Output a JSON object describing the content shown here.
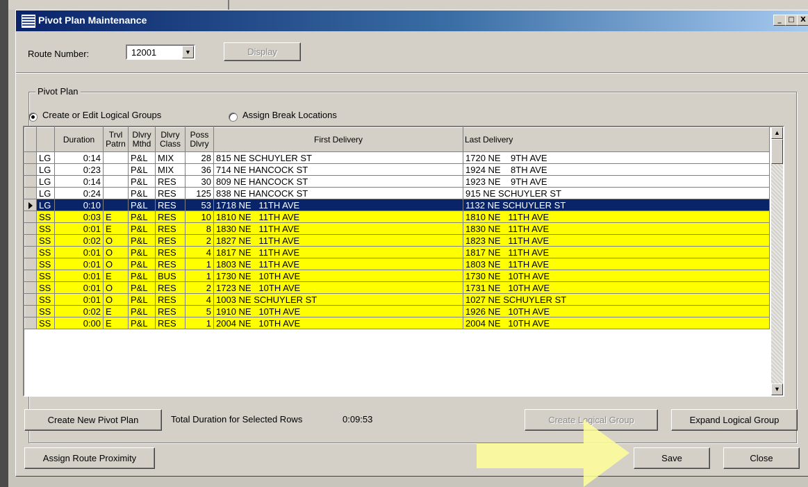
{
  "window": {
    "title": "Pivot Plan Maintenance",
    "minimize_glyph": "_",
    "restore_glyph": "□",
    "close_glyph": "X"
  },
  "route": {
    "label": "Route Number:",
    "value": "12001",
    "display_button": "Display"
  },
  "pivot_plan": {
    "group_title": "Pivot Plan",
    "radio_options": [
      {
        "label": "Create or Edit Logical Groups",
        "selected": true
      },
      {
        "label": "Assign Break Locations",
        "selected": false
      }
    ]
  },
  "grid": {
    "headers": {
      "duration": "Duration",
      "trvl_patrn_1": "Trvl",
      "trvl_patrn_2": "Patrn",
      "dlvry_mthd_1": "Dlvry",
      "dlvry_mthd_2": "Mthd",
      "dlvry_class_1": "Dlvry",
      "dlvry_class_2": "Class",
      "poss_dlvry_1": "Poss",
      "poss_dlvry_2": "Dlvry",
      "first_delivery": "First Delivery",
      "last_delivery": "Last Delivery"
    },
    "rows": [
      {
        "type": "LG",
        "duration": "0:14",
        "patrn": "",
        "mthd": "P&L",
        "class": "MIX",
        "poss": "28",
        "first": "815 NE SCHUYLER ST",
        "last": "1720 NE    9TH AVE",
        "style": "white"
      },
      {
        "type": "LG",
        "duration": "0:23",
        "patrn": "",
        "mthd": "P&L",
        "class": "MIX",
        "poss": "36",
        "first": "714 NE HANCOCK ST",
        "last": "1924 NE    8TH AVE",
        "style": "white"
      },
      {
        "type": "LG",
        "duration": "0:14",
        "patrn": "",
        "mthd": "P&L",
        "class": "RES",
        "poss": "30",
        "first": "809 NE HANCOCK ST",
        "last": "1923 NE    9TH AVE",
        "style": "white"
      },
      {
        "type": "LG",
        "duration": "0:24",
        "patrn": "",
        "mthd": "P&L",
        "class": "RES",
        "poss": "125",
        "first": "838 NE HANCOCK ST",
        "last": "915 NE SCHUYLER ST",
        "style": "white"
      },
      {
        "type": "LG",
        "duration": "0:10",
        "patrn": "",
        "mthd": "P&L",
        "class": "RES",
        "poss": "53",
        "first": "1718 NE   11TH AVE",
        "last": "1132 NE SCHUYLER ST",
        "style": "selected"
      },
      {
        "type": "SS",
        "duration": "0:03",
        "patrn": "E",
        "mthd": "P&L",
        "class": "RES",
        "poss": "10",
        "first": "1810 NE   11TH AVE",
        "last": "1810 NE   11TH AVE",
        "style": "yellow"
      },
      {
        "type": "SS",
        "duration": "0:01",
        "patrn": "E",
        "mthd": "P&L",
        "class": "RES",
        "poss": "8",
        "first": "1830 NE   11TH AVE",
        "last": "1830 NE   11TH AVE",
        "style": "yellow"
      },
      {
        "type": "SS",
        "duration": "0:02",
        "patrn": "O",
        "mthd": "P&L",
        "class": "RES",
        "poss": "2",
        "first": "1827 NE   11TH AVE",
        "last": "1823 NE   11TH AVE",
        "style": "yellow"
      },
      {
        "type": "SS",
        "duration": "0:01",
        "patrn": "O",
        "mthd": "P&L",
        "class": "RES",
        "poss": "4",
        "first": "1817 NE   11TH AVE",
        "last": "1817 NE   11TH AVE",
        "style": "yellow"
      },
      {
        "type": "SS",
        "duration": "0:01",
        "patrn": "O",
        "mthd": "P&L",
        "class": "RES",
        "poss": "1",
        "first": "1803 NE   11TH AVE",
        "last": "1803 NE   11TH AVE",
        "style": "yellow"
      },
      {
        "type": "SS",
        "duration": "0:01",
        "patrn": "E",
        "mthd": "P&L",
        "class": "BUS",
        "poss": "1",
        "first": "1730 NE   10TH AVE",
        "last": "1730 NE   10TH AVE",
        "style": "yellow"
      },
      {
        "type": "SS",
        "duration": "0:01",
        "patrn": "O",
        "mthd": "P&L",
        "class": "RES",
        "poss": "2",
        "first": "1723 NE   10TH AVE",
        "last": "1731 NE   10TH AVE",
        "style": "yellow"
      },
      {
        "type": "SS",
        "duration": "0:01",
        "patrn": "O",
        "mthd": "P&L",
        "class": "RES",
        "poss": "4",
        "first": "1003 NE SCHUYLER ST",
        "last": "1027 NE SCHUYLER ST",
        "style": "yellow"
      },
      {
        "type": "SS",
        "duration": "0:02",
        "patrn": "E",
        "mthd": "P&L",
        "class": "RES",
        "poss": "5",
        "first": "1910 NE   10TH AVE",
        "last": "1926 NE   10TH AVE",
        "style": "yellow"
      },
      {
        "type": "SS",
        "duration": "0:00",
        "patrn": "E",
        "mthd": "P&L",
        "class": "RES",
        "poss": "1",
        "first": "2004 NE   10TH AVE",
        "last": "2004 NE   10TH AVE",
        "style": "yellow"
      }
    ]
  },
  "footer": {
    "create_new_pivot_plan": "Create New Pivot Plan",
    "total_duration_label": "Total Duration for Selected Rows",
    "total_duration_value": "0:09:53",
    "create_logical_group": "Create Logical Group",
    "expand_logical_group": "Expand Logical Group",
    "assign_route_proximity": "Assign Route Proximity",
    "save": "Save",
    "close": "Close"
  },
  "colors": {
    "titlebar": "#0a246a",
    "highlight_row": "#ffff00",
    "selected_row": "#0a246a",
    "callout_arrow": "#ffff99"
  }
}
